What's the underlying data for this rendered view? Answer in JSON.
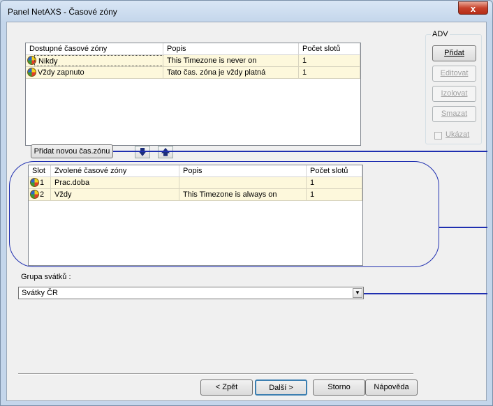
{
  "window": {
    "title": "Panel NetAXS - Časové zóny",
    "close_label": "x"
  },
  "available": {
    "columns": [
      "Dostupné časové zóny",
      "Popis",
      "Počet slotů"
    ],
    "rows": [
      {
        "name": "Nikdy",
        "desc": "This Timezone is never on",
        "slots": "1"
      },
      {
        "name": "Vždy zapnuto",
        "desc": "Tato čas. zóna je vždy platná",
        "slots": "1"
      }
    ]
  },
  "add_new_label": "Přidat novou čas.zónu",
  "move_down_icon": "arrow-down-icon",
  "move_up_icon": "arrow-up-icon",
  "selected": {
    "columns": [
      "Slot",
      "Zvolené časové zóny",
      "Popis",
      "Počet slotů"
    ],
    "rows": [
      {
        "slot": "1",
        "name": "Prac.doba",
        "desc": "",
        "slots": "1"
      },
      {
        "slot": "2",
        "name": "Vždy",
        "desc": "This Timezone is always on",
        "slots": "1"
      }
    ]
  },
  "holiday": {
    "label": "Grupa svátků :",
    "value": "Svátky ČR"
  },
  "adv": {
    "legend": "ADV",
    "add": "Přidat",
    "edit": "Editovat",
    "isolate": "Izolovat",
    "delete": "Smazat",
    "show": "Ukázat"
  },
  "footer": {
    "back": "< Zpět",
    "next": "Další >",
    "cancel": "Storno",
    "help": "Nápověda"
  },
  "colors": {
    "annotation_line": "#1f2fb0",
    "row_bg": "#fdf8dc"
  }
}
